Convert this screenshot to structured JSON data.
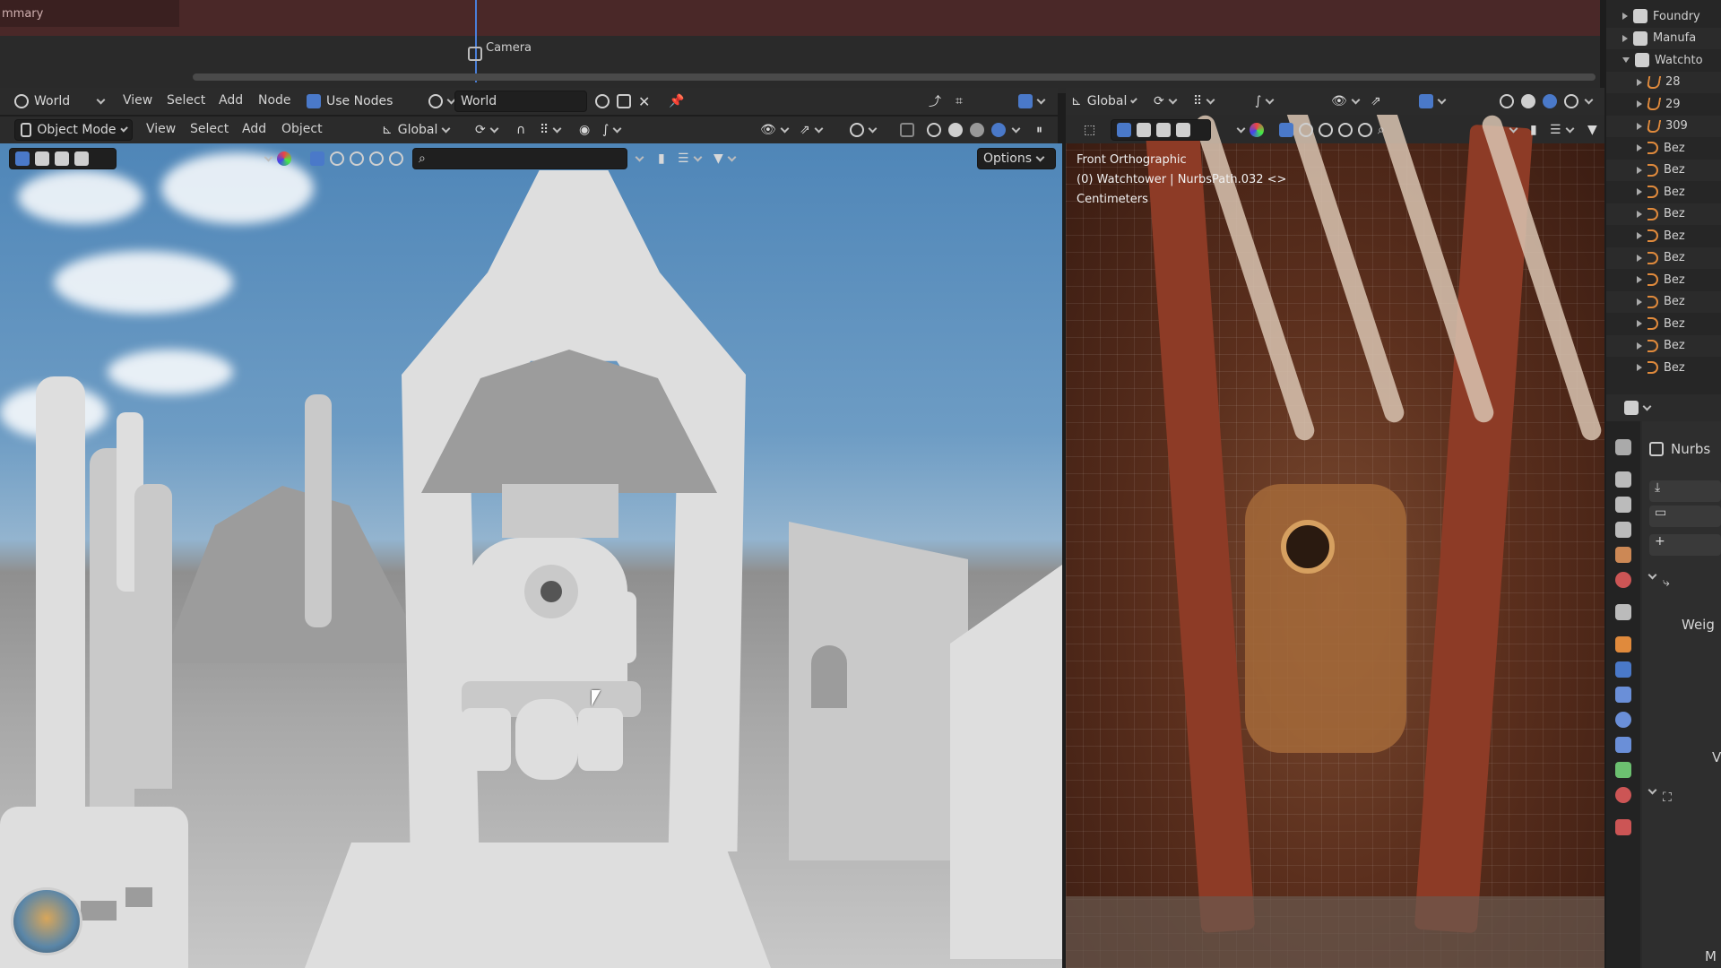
{
  "timeline": {
    "summary_label": "mmary",
    "camera_marker": "Camera"
  },
  "shader_editor": {
    "world_dropdown": "World",
    "menus": [
      "View",
      "Select",
      "Add",
      "Node"
    ],
    "use_nodes_label": "Use Nodes",
    "use_nodes_checked": true,
    "world_datablock": "World"
  },
  "left_viewport": {
    "mode": "Object Mode",
    "menus": [
      "View",
      "Select",
      "Add",
      "Object"
    ],
    "orientation": "Global",
    "options_label": "Options"
  },
  "right_viewport": {
    "orientation": "Global",
    "view_name": "Front Orthographic",
    "object_info": "(0) Watchtower | NurbsPath.032 <>",
    "units": "Centimeters"
  },
  "outliner": {
    "items": [
      {
        "label": "Foundry",
        "icon": "collection-icon",
        "expanded": false
      },
      {
        "label": "Manufa",
        "icon": "collection-icon",
        "expanded": false
      },
      {
        "label": "Watchto",
        "icon": "collection-icon",
        "expanded": true
      },
      {
        "label": "28",
        "icon": "mesh-icon",
        "expanded": false
      },
      {
        "label": "29",
        "icon": "mesh-icon",
        "expanded": false
      },
      {
        "label": "309",
        "icon": "mesh-icon",
        "expanded": false
      },
      {
        "label": "Bez",
        "icon": "curve-icon",
        "expanded": false
      },
      {
        "label": "Bez",
        "icon": "curve-icon",
        "expanded": false
      },
      {
        "label": "Bez",
        "icon": "curve-icon",
        "expanded": false
      },
      {
        "label": "Bez",
        "icon": "curve-icon",
        "expanded": false
      },
      {
        "label": "Bez",
        "icon": "curve-icon",
        "expanded": false
      },
      {
        "label": "Bez",
        "icon": "curve-icon",
        "expanded": false
      },
      {
        "label": "Bez",
        "icon": "curve-icon",
        "expanded": false
      },
      {
        "label": "Bez",
        "icon": "curve-icon",
        "expanded": false
      },
      {
        "label": "Bez",
        "icon": "curve-icon",
        "expanded": false
      },
      {
        "label": "Bez",
        "icon": "curve-icon",
        "expanded": false
      },
      {
        "label": "Bez",
        "icon": "curve-icon",
        "expanded": false
      }
    ]
  },
  "properties": {
    "object_name": "Nurbs",
    "weight_label": "Weig",
    "v_label": "V",
    "m_label": "M"
  },
  "colors": {
    "accent": "#4a79c9",
    "object_orange": "#e08a3c",
    "summary_red": "#4a2828"
  }
}
